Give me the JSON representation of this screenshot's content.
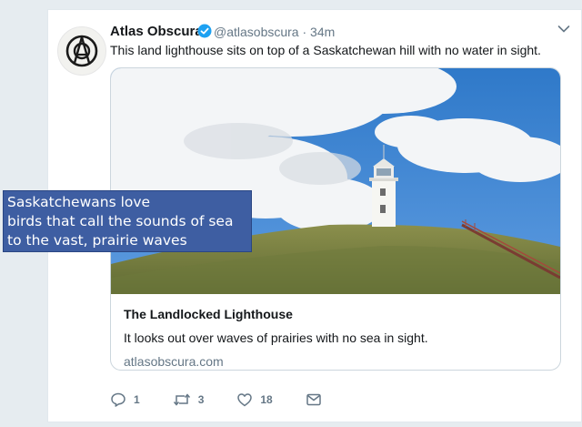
{
  "tweet": {
    "author_name": "Atlas Obscura",
    "handle": "@atlasobscura",
    "separator": "·",
    "time": "34m",
    "text": "This land lighthouse sits on top of a Saskatchewan hill with no water in sight."
  },
  "link_card": {
    "title": "The Landlocked Lighthouse",
    "description": "It looks out over waves of prairies with no sea in sight.",
    "domain": "atlasobscura.com"
  },
  "actions": {
    "replies": "1",
    "retweets": "3",
    "likes": "18"
  },
  "overlay_caption": [
    "Saskatchewans love",
    "birds that call the sounds of sea",
    "to the vast, prairie waves"
  ],
  "colors": {
    "accent": "#1da1f2",
    "overlay_bg": "#3e5ea2",
    "muted_text": "#657786"
  },
  "icons": [
    "atlas-obscura-logo",
    "verified-badge-icon",
    "chevron-down-icon",
    "reply-icon",
    "retweet-icon",
    "heart-icon",
    "message-icon"
  ]
}
